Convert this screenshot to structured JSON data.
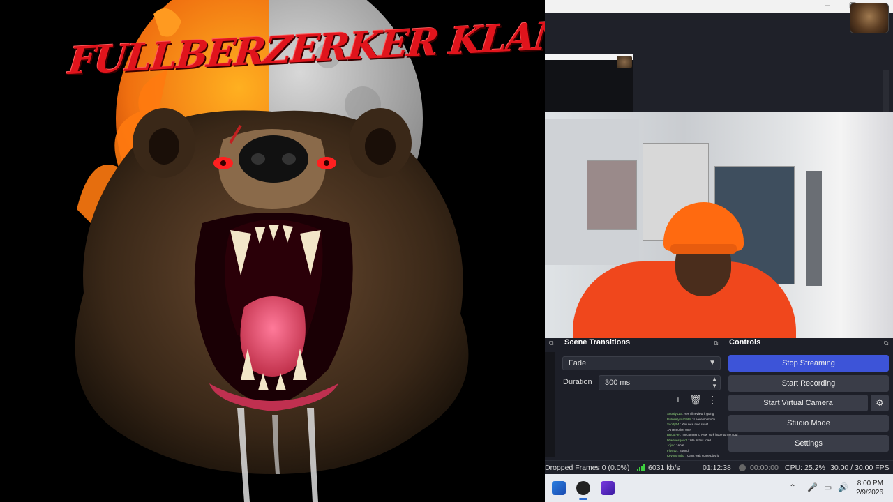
{
  "artwork": {
    "title": "FULLBERZERKER KLAN"
  },
  "obs": {
    "transitions": {
      "dock_title": "Scene Transitions",
      "selected": "Fade",
      "duration_label": "Duration",
      "duration_value": "300 ms"
    },
    "controls": {
      "dock_title": "Controls",
      "buttons": [
        "Stop Streaming",
        "Start Recording",
        "Start Virtual Camera",
        "Studio Mode",
        "Settings"
      ]
    },
    "status": {
      "dropped_frames": "Dropped Frames 0 (0.0%)",
      "bitrate": "6031 kb/s",
      "stream_time": "01:12:38",
      "record_time": "00:00:00",
      "cpu": "CPU: 25.2%",
      "fps": "30.00 / 30.00 FPS"
    }
  },
  "chat": [
    {
      "user": "Snoaly113",
      "msg": "Yes I'll review it going"
    },
    {
      "user": "BallerAlyssa1998",
      "msg": "Leave so much"
    },
    {
      "user": "Scotty54",
      "msg": "You nice nice roast"
    },
    {
      "user": "",
      "msg": "An emotion one"
    },
    {
      "user": "BRoot-ie",
      "msg": "I'm coming to New York hope to me soul"
    },
    {
      "user": "bbwavesgoodt",
      "msg": "We in this road"
    },
    {
      "user": "Jojolo",
      "msg": "Aha!"
    },
    {
      "user": "Flowzz",
      "msg": "Sound"
    },
    {
      "user": "KevinSmith1",
      "msg": "Can't wait some play it"
    }
  ],
  "taskbar": {
    "time": "8:00 PM",
    "date": "2/9/2026"
  },
  "colors": {
    "obs_accent": "#3d54d8",
    "title_red": "#e0141c",
    "shirt_orange": "#f0471c",
    "signal_green": "#3ecf3e"
  }
}
